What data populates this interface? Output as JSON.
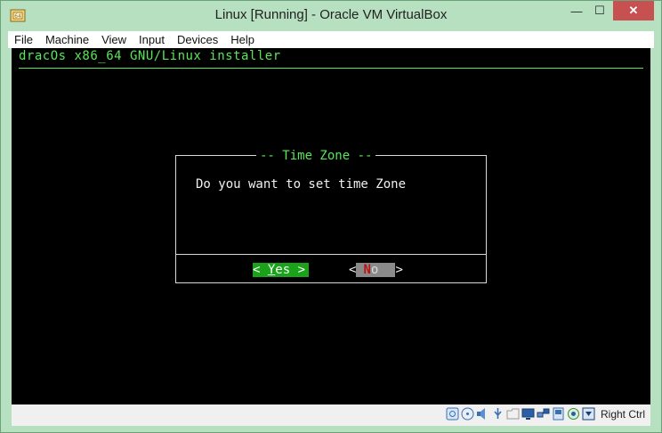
{
  "window": {
    "title": "Linux [Running] - Oracle VM VirtualBox",
    "min_icon": "minimize-icon",
    "max_icon": "maximize-icon",
    "close_icon": "close-icon",
    "min_glyph": "—",
    "max_glyph": "☐",
    "close_glyph": "✕"
  },
  "menu": {
    "items": [
      "File",
      "Machine",
      "View",
      "Input",
      "Devices",
      "Help"
    ]
  },
  "screen": {
    "installer_title": "dracOs x86_64 GNU/Linux installer",
    "dialog": {
      "title": "-- Time Zone --",
      "message": "Do you want to set time Zone",
      "yes": {
        "left": "< ",
        "hot": "Y",
        "rest": "es >"
      },
      "no": {
        "left": "<",
        "hot": "N",
        "rest": "o",
        "right": ">"
      }
    }
  },
  "statusbar": {
    "icons": [
      "hard-disk-icon",
      "optical-drive-icon",
      "audio-icon",
      "usb-icon",
      "shared-folder-icon",
      "display-icon",
      "network-icon",
      "video-capture-icon",
      "recording-icon",
      "cpu-icon",
      "mouse-integration-icon"
    ],
    "host_key": "Right Ctrl"
  },
  "colors": {
    "terminal_green": "#56e856",
    "yes_button": "#1aa31a",
    "no_button": "#8a8a8a",
    "title_bar": "#b6e0c0",
    "close_button": "#c75050"
  }
}
